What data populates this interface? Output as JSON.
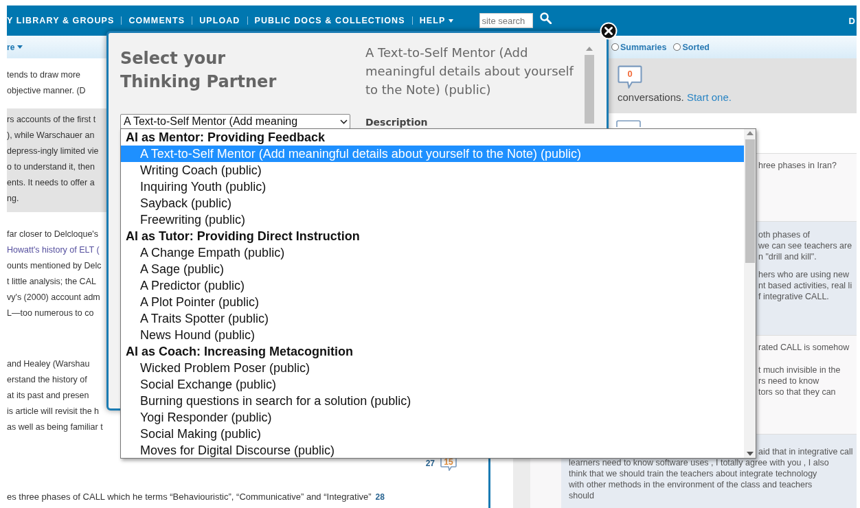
{
  "nav": {
    "items": [
      "Y LIBRARY & GROUPS",
      "COMMENTS",
      "UPLOAD",
      "PUBLIC DOCS & COLLECTIONS",
      "HELP"
    ],
    "search_placeholder": "site search",
    "corner_text": "D"
  },
  "left_toolbar": {
    "label": "re"
  },
  "article": {
    "blocks": [
      {
        "highlighted": false,
        "lines": [
          "tends to draw more",
          "objective manner. (D"
        ]
      },
      {
        "highlighted": true,
        "lines": [
          "rs accounts of the first t",
          "), while Warschauer an",
          "depress-ingly limited vie",
          "o to understand it, then",
          "ents. It needs to offer a",
          "ng."
        ]
      },
      {
        "highlighted": false,
        "lines": [
          "far closer to Delcloque's",
          "Howatt's history of ELT (",
          "ounts mentioned by Delc",
          "t little analysis; the CAL",
          "vy's (2000) account adm",
          "L—too numerous to co"
        ]
      },
      {
        "highlighted": false,
        "lines": [
          "and Healey (Warshau",
          "erstand the history of",
          "at its past and presen",
          "is article will revisit the h",
          "as well as being familiar t"
        ]
      }
    ],
    "paragraph_number": "27",
    "comment_count": "15",
    "last_line": "es three phases of CALL which he terms “Behaviouristic”, “Communicative” and “Integrative”",
    "last_paragraph_number": "28"
  },
  "right_panel": {
    "view_options": [
      {
        "label": "Summaries",
        "selected": false
      },
      {
        "label": "Sorted",
        "selected": false
      }
    ],
    "comment_count": "0",
    "prompt_text": "conversations.",
    "prompt_link": "Start one.",
    "comments": [
      {
        "shaded": false,
        "fragments": [
          [
            "hree phases in Iran?"
          ]
        ]
      },
      {
        "shaded": true,
        "fragments": [
          [
            "oth phases of",
            "we can see teachers are",
            "n \"drill and kill\"."
          ],
          [
            "hers who are using new",
            "nt based activities, real li",
            "f integrative CALL."
          ]
        ]
      },
      {
        "shaded": false,
        "fragments": [
          [
            "rated CALL is somehow"
          ],
          [
            "t much invisible in the",
            "rs need to know",
            "tors so that they can"
          ]
        ]
      },
      {
        "shaded": true,
        "fragments": [
          [
            "aid that in integrative call"
          ]
        ],
        "lines": [
          "learners need to know software uses , I totally agree with you , I also",
          "think that we should train the teachers about integrate technology",
          "with other methods in the environment of the class and teachers",
          "should"
        ]
      }
    ]
  },
  "modal": {
    "title": "Select your Thinking Partner",
    "select_value": "A Text-to-Self Mentor (Add meaning",
    "detail_title": "A Text-to-Self Mentor (Add meaningful details about yourself to the Note) (public)",
    "description_label": "Description"
  },
  "dropdown": {
    "groups": [
      {
        "label": "AI as Mentor: Providing Feedback",
        "options": [
          {
            "label": "A Text-to-Self Mentor (Add meaningful details about yourself to the Note) (public)",
            "selected": true
          },
          {
            "label": "Writing Coach (public)",
            "selected": false
          },
          {
            "label": "Inquiring Youth (public)",
            "selected": false
          },
          {
            "label": "Sayback (public)",
            "selected": false
          },
          {
            "label": "Freewriting (public)",
            "selected": false
          }
        ]
      },
      {
        "label": "AI as Tutor: Providing Direct Instruction",
        "options": [
          {
            "label": "A Change Empath (public)",
            "selected": false
          },
          {
            "label": "A Sage (public)",
            "selected": false
          },
          {
            "label": "A Predictor (public)",
            "selected": false
          },
          {
            "label": "A Plot Pointer (public)",
            "selected": false
          },
          {
            "label": "A Traits Spotter (public)",
            "selected": false
          },
          {
            "label": "News Hound (public)",
            "selected": false
          }
        ]
      },
      {
        "label": "AI as Coach: Increasing Metacognition",
        "options": [
          {
            "label": "Wicked Problem Poser (public)",
            "selected": false
          },
          {
            "label": "Social Exchange (public)",
            "selected": false
          },
          {
            "label": "Burning questions in search for a solution (public)",
            "selected": false
          },
          {
            "label": "Yogi Responder (public)",
            "selected": false
          },
          {
            "label": "Social Making (public)",
            "selected": false
          },
          {
            "label": "Moves for Digital Discourse (public)",
            "selected": false
          }
        ]
      }
    ]
  }
}
